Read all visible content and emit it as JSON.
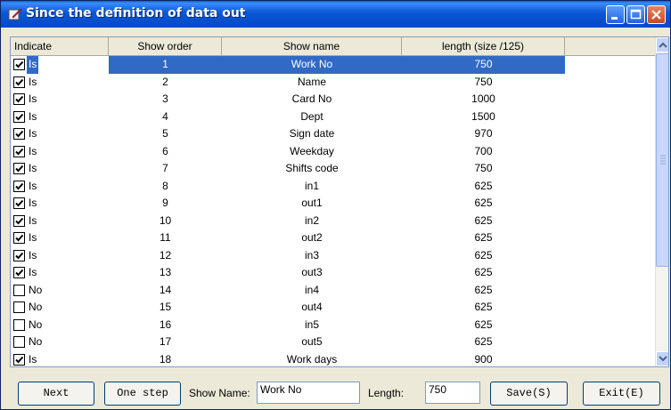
{
  "window": {
    "title": "Since the definition of data out"
  },
  "columns": [
    "Indicate",
    "Show order",
    "Show name",
    "length (size /125)"
  ],
  "rows": [
    {
      "checked": true,
      "indicate": "Is",
      "order": "1",
      "name": "Work No",
      "length": "750",
      "selected": true
    },
    {
      "checked": true,
      "indicate": "Is",
      "order": "2",
      "name": "Name",
      "length": "750"
    },
    {
      "checked": true,
      "indicate": "Is",
      "order": "3",
      "name": "Card No",
      "length": "1000"
    },
    {
      "checked": true,
      "indicate": "Is",
      "order": "4",
      "name": "Dept",
      "length": "1500"
    },
    {
      "checked": true,
      "indicate": "Is",
      "order": "5",
      "name": "Sign date",
      "length": "970"
    },
    {
      "checked": true,
      "indicate": "Is",
      "order": "6",
      "name": "Weekday",
      "length": "700"
    },
    {
      "checked": true,
      "indicate": "Is",
      "order": "7",
      "name": "Shifts code",
      "length": "750"
    },
    {
      "checked": true,
      "indicate": "Is",
      "order": "8",
      "name": "in1",
      "length": "625"
    },
    {
      "checked": true,
      "indicate": "Is",
      "order": "9",
      "name": "out1",
      "length": "625"
    },
    {
      "checked": true,
      "indicate": "Is",
      "order": "10",
      "name": "in2",
      "length": "625"
    },
    {
      "checked": true,
      "indicate": "Is",
      "order": "11",
      "name": "out2",
      "length": "625"
    },
    {
      "checked": true,
      "indicate": "Is",
      "order": "12",
      "name": "in3",
      "length": "625"
    },
    {
      "checked": true,
      "indicate": "Is",
      "order": "13",
      "name": "out3",
      "length": "625"
    },
    {
      "checked": false,
      "indicate": "No",
      "order": "14",
      "name": "in4",
      "length": "625"
    },
    {
      "checked": false,
      "indicate": "No",
      "order": "15",
      "name": "out4",
      "length": "625"
    },
    {
      "checked": false,
      "indicate": "No",
      "order": "16",
      "name": "in5",
      "length": "625"
    },
    {
      "checked": false,
      "indicate": "No",
      "order": "17",
      "name": "out5",
      "length": "625"
    },
    {
      "checked": true,
      "indicate": "Is",
      "order": "18",
      "name": "Work days",
      "length": "900"
    }
  ],
  "buttons": {
    "next": "Next",
    "one_step": "One step",
    "save": "Save(S)",
    "exit": "Exit(E)"
  },
  "fields": {
    "show_name_label": "Show Name:",
    "show_name_value": "Work No",
    "length_label": "Length:",
    "length_value": "750"
  }
}
